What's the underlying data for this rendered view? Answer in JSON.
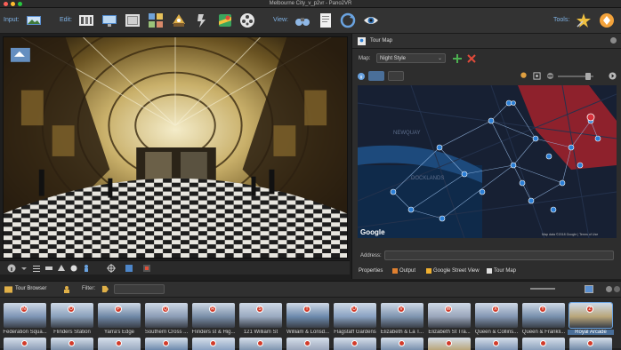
{
  "window": {
    "title": "Melbourne City_v_p2vr - Pano2VR"
  },
  "toolbar": {
    "input_label": "Input:",
    "edit_label": "Edit:",
    "view_label": "View:",
    "tools_label": "Tools:"
  },
  "right_panel": {
    "title": "Tour Map",
    "map_label": "Map:",
    "map_style": "Night Style",
    "map_attribution": "Map data ©2018 Google | Terms of Use",
    "google_logo": "Google",
    "map_place_1": "NEWQUAY",
    "map_place_2": "DOCKLANDS",
    "address_label": "Address:",
    "address_value": "",
    "tabs": [
      {
        "label": "Properties"
      },
      {
        "label": "Output"
      },
      {
        "label": "Google Street View"
      },
      {
        "label": "Tour Map"
      }
    ]
  },
  "tour_browser": {
    "title": "Tour Browser",
    "filter_label": "Filter:",
    "filter_value": "",
    "items": [
      {
        "label": "Federation Squa...",
        "pin": "N"
      },
      {
        "label": "Flinders Station",
        "pin": "O"
      },
      {
        "label": "Yarra's Edge",
        "pin": "P"
      },
      {
        "label": "Southern Cross ...",
        "pin": "Q"
      },
      {
        "label": "Flinders st & Hig...",
        "pin": "R"
      },
      {
        "label": "121 William St",
        "pin": "S"
      },
      {
        "label": "William & Lonsd...",
        "pin": "T"
      },
      {
        "label": "Flagstaff Gardens",
        "pin": "U"
      },
      {
        "label": "Elizabeth & La T...",
        "pin": "V"
      },
      {
        "label": "Elizabeth St Tra...",
        "pin": "W"
      },
      {
        "label": "Queen & Collins...",
        "pin": "X"
      },
      {
        "label": "Queen & Frankli...",
        "pin": "Y"
      },
      {
        "label": "Royal Arcade",
        "pin": "Z"
      }
    ]
  },
  "colors": {
    "accent_blue": "#7fb2e5",
    "pin_red": "#d23b2a",
    "map_blue": "#2c7fd6",
    "map_highlight": "#d8303a"
  }
}
